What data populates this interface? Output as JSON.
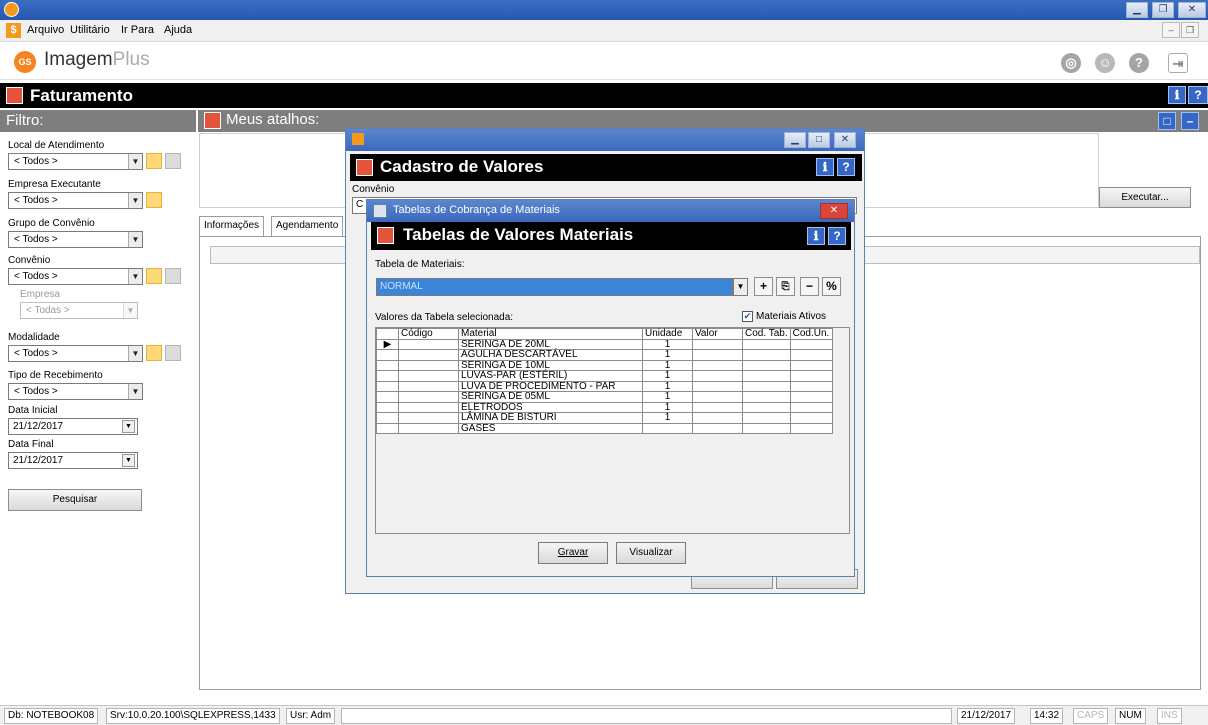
{
  "menu": {
    "items": [
      "Arquivo",
      "Utilitário",
      "Ir Para",
      "Ajuda"
    ]
  },
  "logo": {
    "brand": "Imagem",
    "suffix": "Plus",
    "mark": "GS"
  },
  "module": {
    "title": "Faturamento"
  },
  "filter": {
    "header": "Filtro:",
    "local_label": "Local de Atendimento",
    "local_value": "< Todos >",
    "empresa_exec_label": "Empresa Executante",
    "empresa_exec_value": "< Todos >",
    "grupo_label": "Grupo de Convênio",
    "grupo_value": "< Todos >",
    "convenio_label": "Convênio",
    "convenio_value": "< Todos >",
    "empresa_label": "Empresa",
    "empresa_value": "< Todas >",
    "modalidade_label": "Modalidade",
    "modalidade_value": "< Todos >",
    "tipo_receb_label": "Tipo de Recebimento",
    "tipo_receb_value": "< Todos >",
    "data_inicial_label": "Data Inicial",
    "data_inicial_value": "21/12/2017",
    "data_final_label": "Data Final",
    "data_final_value": "21/12/2017",
    "search_button": "Pesquisar"
  },
  "shortcuts": {
    "header": "Meus atalhos:",
    "execute_button": "Executar..."
  },
  "tabs": [
    "Informações",
    "Agendamento"
  ],
  "cadastro": {
    "title": "Cadastro de Valores",
    "convenio_label": "Convênio",
    "convenio_value": "C"
  },
  "materiais": {
    "window_title": "Tabelas de Cobrança de Materiais",
    "title": "Tabelas de Valores Materiais",
    "table_label": "Tabela de Materiais:",
    "table_value": "NORMAL",
    "values_label": "Valores da Tabela selecionada:",
    "active_label": "Materiais Ativos",
    "active_checked": true,
    "columns": [
      "Código",
      "Material",
      "Unidade",
      "Valor",
      "Cod. Tab.",
      "Cod.Un."
    ],
    "rows": [
      {
        "codigo": "",
        "material": "SERINGA DE 20ML",
        "unidade": "1",
        "valor": "",
        "cod_tab": "",
        "cod_un": ""
      },
      {
        "codigo": "",
        "material": "AGULHA DESCARTÁVEL",
        "unidade": "1",
        "valor": "",
        "cod_tab": "",
        "cod_un": ""
      },
      {
        "codigo": "",
        "material": "SERINGA DE 10ML",
        "unidade": "1",
        "valor": "",
        "cod_tab": "",
        "cod_un": ""
      },
      {
        "codigo": "",
        "material": "LUVAS-PAR (ESTÉRIL)",
        "unidade": "1",
        "valor": "",
        "cod_tab": "",
        "cod_un": ""
      },
      {
        "codigo": "",
        "material": "LUVA DE PROCEDIMENTO - PAR",
        "unidade": "1",
        "valor": "",
        "cod_tab": "",
        "cod_un": ""
      },
      {
        "codigo": "",
        "material": "SERINGA DE 05ML",
        "unidade": "1",
        "valor": "",
        "cod_tab": "",
        "cod_un": ""
      },
      {
        "codigo": "",
        "material": "ELETRODOS",
        "unidade": "1",
        "valor": "",
        "cod_tab": "",
        "cod_un": ""
      },
      {
        "codigo": "",
        "material": "LÂMINA DE BISTURI",
        "unidade": "1",
        "valor": "",
        "cod_tab": "",
        "cod_un": ""
      },
      {
        "codigo": "",
        "material": "GASES",
        "unidade": "",
        "valor": "",
        "cod_tab": "",
        "cod_un": ""
      }
    ],
    "save_button": "Gravar",
    "view_button": "Visualizar"
  },
  "status": {
    "db": "Db: NOTEBOOK08",
    "srv": "Srv:10.0.20.100\\SQLEXPRESS,1433",
    "usr": "Usr: Adm",
    "date": "21/12/2017",
    "time": "14:32",
    "caps": "CAPS",
    "num": "NUM",
    "ins": "INS"
  },
  "colors": {
    "titlebar": "#2f62bd",
    "header_black": "#000000",
    "panel_gray": "#7e7e7e",
    "selection_blue": "#3a85d8",
    "accent_orange": "#f5831f",
    "icon_red": "#e4533b"
  },
  "icons": {
    "app": "app-logo-icon",
    "globe": "globe-icon",
    "user": "user-icon",
    "help": "help-icon",
    "exit": "exit-icon",
    "star": "favorite-icon",
    "grid": "list-icon"
  }
}
